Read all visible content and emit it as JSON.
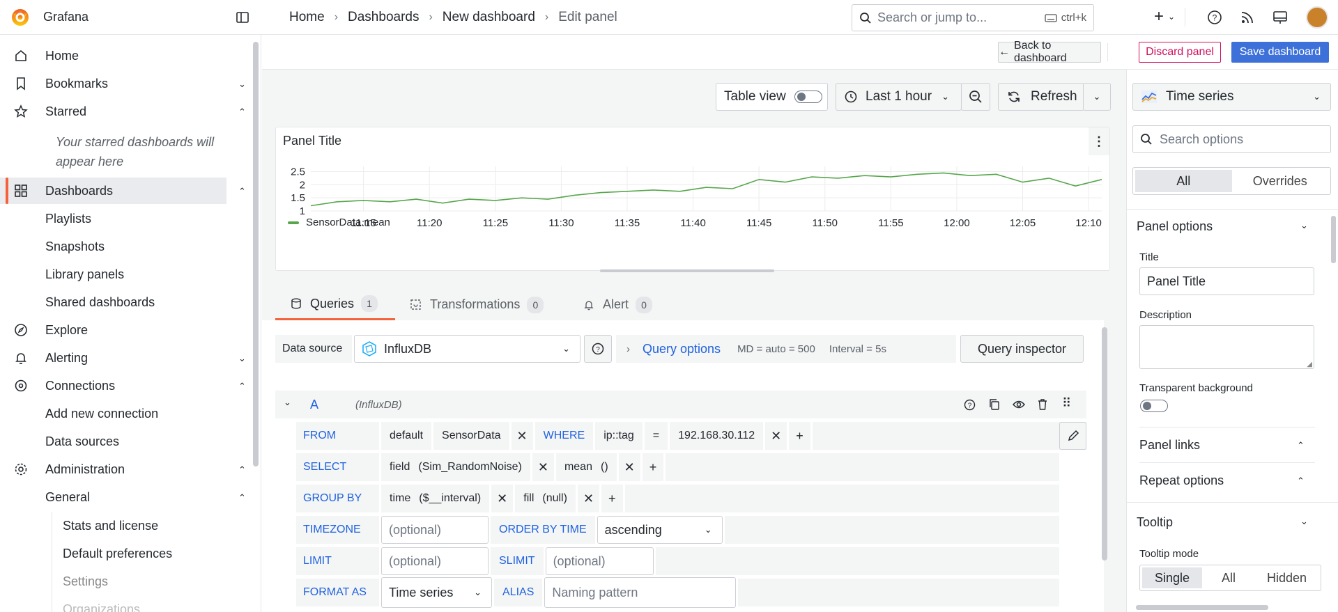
{
  "app": {
    "name": "Grafana"
  },
  "breadcrumb": [
    "Home",
    "Dashboards",
    "New dashboard",
    "Edit panel"
  ],
  "search": {
    "placeholder": "Search or jump to...",
    "shortcut": "ctrl+k"
  },
  "sidebar": {
    "home": "Home",
    "bookmarks": "Bookmarks",
    "starred": "Starred",
    "starred_note": "Your starred dashboards will appear here",
    "dashboards": "Dashboards",
    "dashboards_children": [
      "Playlists",
      "Snapshots",
      "Library panels",
      "Shared dashboards"
    ],
    "explore": "Explore",
    "alerting": "Alerting",
    "connections": "Connections",
    "connections_children": [
      "Add new connection",
      "Data sources"
    ],
    "administration": "Administration",
    "general": "General",
    "general_children": [
      "Stats and license",
      "Default preferences",
      "Settings",
      "Organizations"
    ]
  },
  "editbar": {
    "back": "Back to dashboard",
    "discard": "Discard panel",
    "save": "Save dashboard"
  },
  "toolbar": {
    "table_view": "Table view",
    "time_range": "Last 1 hour",
    "refresh": "Refresh"
  },
  "panel": {
    "title": "Panel Title",
    "legend": "SensorData.mean"
  },
  "chart_data": {
    "type": "line",
    "title": "Panel Title",
    "xlabel": "",
    "ylabel": "",
    "yticks": [
      "2.5",
      "2",
      "1.5",
      "1"
    ],
    "ylim": [
      1,
      2.7
    ],
    "xticks": [
      "11:15",
      "11:20",
      "11:25",
      "11:30",
      "11:35",
      "11:40",
      "11:45",
      "11:50",
      "11:55",
      "12:00",
      "12:05",
      "12:10"
    ],
    "series": [
      {
        "name": "SensorData.mean",
        "color": "#56a64b",
        "x": [
          "11:11",
          "11:13",
          "11:15",
          "11:17",
          "11:19",
          "11:21",
          "11:23",
          "11:25",
          "11:27",
          "11:29",
          "11:31",
          "11:33",
          "11:35",
          "11:37",
          "11:39",
          "11:41",
          "11:43",
          "11:45",
          "11:47",
          "11:49",
          "11:51",
          "11:53",
          "11:55",
          "11:57",
          "11:59",
          "12:01",
          "12:03",
          "12:05",
          "12:07",
          "12:09",
          "12:11"
        ],
        "values": [
          1.2,
          1.35,
          1.4,
          1.35,
          1.45,
          1.3,
          1.45,
          1.4,
          1.5,
          1.45,
          1.6,
          1.7,
          1.75,
          1.8,
          1.75,
          1.9,
          1.85,
          2.2,
          2.1,
          2.3,
          2.25,
          2.35,
          2.3,
          2.4,
          2.45,
          2.35,
          2.4,
          2.1,
          2.25,
          1.95,
          2.2
        ]
      }
    ]
  },
  "query_tabs": [
    {
      "label": "Queries",
      "count": "1"
    },
    {
      "label": "Transformations",
      "count": "0"
    },
    {
      "label": "Alert",
      "count": "0"
    }
  ],
  "datasource": {
    "label": "Data source",
    "value": "InfluxDB",
    "query_options": "Query options",
    "md": "MD = auto = 500",
    "interval": "Interval = 5s",
    "inspector": "Query inspector"
  },
  "query": {
    "ref": "A",
    "ds": "(InfluxDB)",
    "from": {
      "kw": "FROM",
      "policy": "default",
      "measurement": "SensorData",
      "where": "WHERE",
      "tag": "ip::tag",
      "op": "=",
      "value": "192.168.30.112"
    },
    "select": {
      "kw": "SELECT",
      "field": "field",
      "field_arg": "(Sim_RandomNoise)",
      "fn": "mean",
      "fn_arg": "()"
    },
    "group": {
      "kw": "GROUP BY",
      "time": "time",
      "time_arg": "($__interval)",
      "fill": "fill",
      "fill_arg": "(null)"
    },
    "timezone": {
      "kw": "TIMEZONE",
      "placeholder": "(optional)",
      "order_kw": "ORDER BY TIME",
      "order_value": "ascending"
    },
    "limit": {
      "kw": "LIMIT",
      "placeholder": "(optional)",
      "slimit_kw": "SLIMIT",
      "slimit_placeholder": "(optional)"
    },
    "format": {
      "kw": "FORMAT AS",
      "value": "Time series",
      "alias_kw": "ALIAS",
      "alias_placeholder": "Naming pattern"
    }
  },
  "options": {
    "viz": "Time series",
    "search_placeholder": "Search options",
    "tab_all": "All",
    "tab_overrides": "Overrides",
    "panel_options": "Panel options",
    "title_label": "Title",
    "title_value": "Panel Title",
    "description_label": "Description",
    "transparent_label": "Transparent background",
    "panel_links": "Panel links",
    "repeat_options": "Repeat options",
    "tooltip": "Tooltip",
    "tooltip_mode": "Tooltip mode",
    "tooltip_modes": [
      "Single",
      "All",
      "Hidden"
    ]
  },
  "colors": {
    "accent": "#3d71d9",
    "brand": "#f5613b",
    "series": "#56a64b",
    "danger": "#d10e5c"
  }
}
